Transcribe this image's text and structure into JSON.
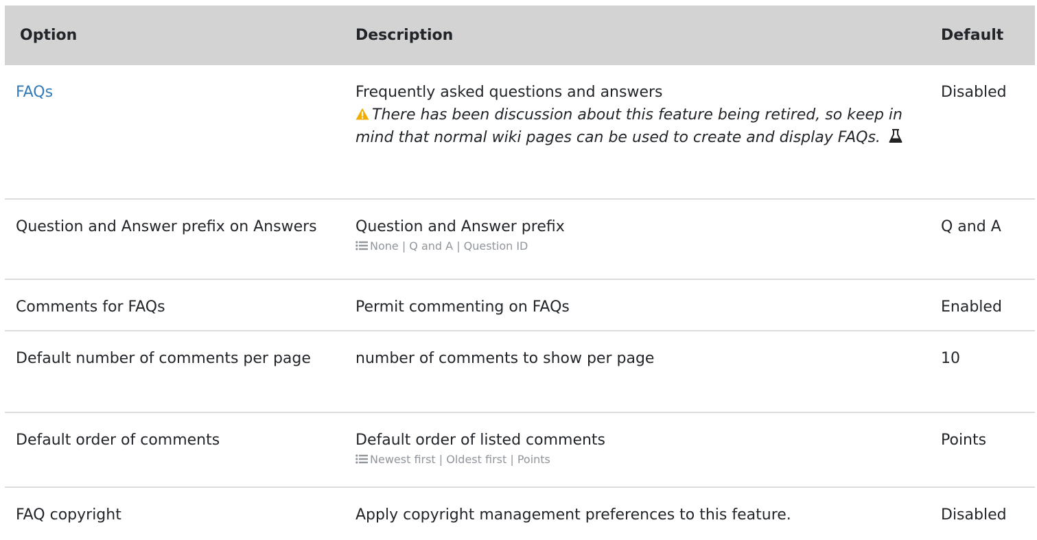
{
  "table": {
    "headers": {
      "option": "Option",
      "description": "Description",
      "default": "Default"
    },
    "rows": [
      {
        "option": "FAQs",
        "option_is_link": true,
        "description": "Frequently asked questions and answers",
        "warning": "There has been discussion about this feature being retired, so keep in mind that normal wiki pages can be used to create and display FAQs.",
        "warning_icon": "warning-icon",
        "experimental_icon": "flask-icon",
        "default": "Disabled"
      },
      {
        "option": "Question and Answer prefix on Answers",
        "description": "Question and Answer prefix",
        "options_icon": "list-icon",
        "options": "None | Q and A | Question ID",
        "default": "Q and A"
      },
      {
        "option": "Comments for FAQs",
        "description": "Permit commenting on FAQs",
        "default": "Enabled"
      },
      {
        "option": "Default number of comments per page",
        "description": "number of comments to show per page",
        "default": "10"
      },
      {
        "option": "Default order of comments",
        "description": "Default order of listed comments",
        "options_icon": "list-icon",
        "options": "Newest first | Oldest first | Points",
        "default": "Points"
      },
      {
        "option": "FAQ copyright",
        "description": "Apply copyright management preferences to this feature.",
        "default": "Disabled"
      }
    ]
  },
  "colors": {
    "header_bg": "#d3d3d3",
    "link": "#337ab7",
    "warning": "#f0ad00",
    "muted": "#8f959b",
    "row_border": "#dcdcdc"
  }
}
